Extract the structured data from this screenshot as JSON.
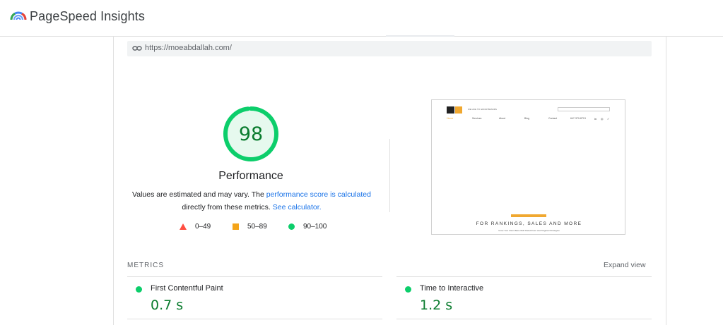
{
  "header": {
    "app_title": "PageSpeed Insights",
    "logo_icon": "pagespeed-logo-icon"
  },
  "url_bar": {
    "icon": "link-icon",
    "url": "https://moeabdallah.com/"
  },
  "performance": {
    "score": "98",
    "score_fraction": 0.98,
    "title": "Performance",
    "note_prefix": "Values are estimated and may vary. The ",
    "note_link1": "performance score is calculated",
    "note_middle": "directly from these metrics. ",
    "note_link2": "See calculator.",
    "colors": {
      "good": "#0cce6b",
      "average": "#f4a419",
      "poor": "#ff4e42",
      "link": "#1a73e8"
    }
  },
  "legend": [
    {
      "icon": "red-triangle-icon",
      "label": "0–49"
    },
    {
      "icon": "orange-square-icon",
      "label": "50–89"
    },
    {
      "icon": "green-circle-icon",
      "label": "90–100"
    }
  ],
  "screenshot": {
    "tagline": "WE LIKE TO GROW BRANDS",
    "nav": [
      "Home",
      "Services",
      "About",
      "Blog",
      "Contact",
      "647-379-8713"
    ],
    "social": [
      "in",
      "◎",
      "✓"
    ],
    "headline": "FOR RANKINGS, SALES AND MORE",
    "subline": "Grow Your Client Base With Data-Driven and Targeted Strategies"
  },
  "metrics": {
    "label": "METRICS",
    "expand_view": "Expand view",
    "items": [
      {
        "name": "First Contentful Paint",
        "value": "0.7 s"
      },
      {
        "name": "Time to Interactive",
        "value": "1.2 s"
      }
    ]
  }
}
